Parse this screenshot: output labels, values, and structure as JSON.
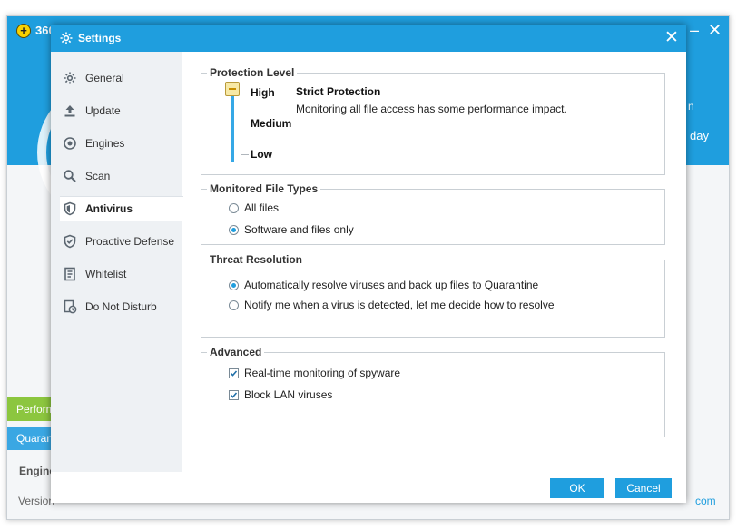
{
  "background_app": {
    "title": "360",
    "right_text_1": "n",
    "right_text_2": "day",
    "tabs": [
      "Perform",
      "Quaran"
    ],
    "engine_label": "Engine",
    "version_label": "Version",
    "footer_link_fragment": "com"
  },
  "dialog": {
    "title": "Settings",
    "close_label": "✕"
  },
  "sidebar": {
    "items": [
      {
        "label": "General",
        "icon": "gear-icon"
      },
      {
        "label": "Update",
        "icon": "upload-icon"
      },
      {
        "label": "Engines",
        "icon": "engine-icon"
      },
      {
        "label": "Scan",
        "icon": "magnifier-icon"
      },
      {
        "label": "Antivirus",
        "icon": "shield-icon"
      },
      {
        "label": "Proactive Defense",
        "icon": "shield-check-icon"
      },
      {
        "label": "Whitelist",
        "icon": "document-icon"
      },
      {
        "label": "Do Not Disturb",
        "icon": "clock-doc-icon"
      }
    ],
    "active_index": 4
  },
  "protection_level": {
    "heading": "Protection Level",
    "levels": [
      "High",
      "Medium",
      "Low"
    ],
    "selected": "High",
    "title": "Strict Protection",
    "description": "Monitoring all file access has some performance impact."
  },
  "monitored_file_types": {
    "heading": "Monitored File Types",
    "options": [
      "All files",
      "Software and files only"
    ],
    "selected_index": 1
  },
  "threat_resolution": {
    "heading": "Threat Resolution",
    "options": [
      "Automatically resolve viruses and back up files to Quarantine",
      "Notify me when a virus is detected, let me decide how to resolve"
    ],
    "selected_index": 0
  },
  "advanced": {
    "heading": "Advanced",
    "options": [
      {
        "label": "Real-time monitoring of spyware",
        "checked": true
      },
      {
        "label": "Block LAN viruses",
        "checked": true
      }
    ]
  },
  "footer": {
    "ok_label": "OK",
    "cancel_label": "Cancel"
  },
  "colors": {
    "accent": "#1f9ede",
    "sidebar_bg": "#eef1f4",
    "performance_tab": "#8cc63f"
  }
}
